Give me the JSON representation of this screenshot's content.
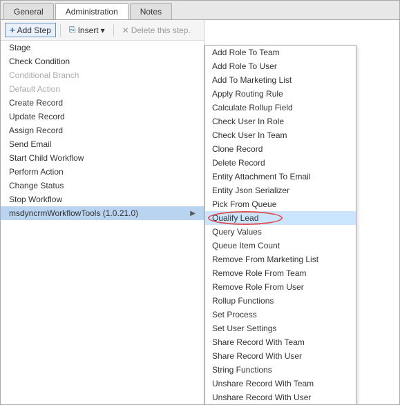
{
  "tabs": [
    {
      "label": "General",
      "active": false
    },
    {
      "label": "Administration",
      "active": true
    },
    {
      "label": "Notes",
      "active": false
    }
  ],
  "toolbar": {
    "add_step_label": "Add Step",
    "insert_label": "Insert",
    "delete_label": "Delete this step."
  },
  "menu_items": [
    {
      "label": "Stage",
      "disabled": false
    },
    {
      "label": "Check Condition",
      "disabled": false
    },
    {
      "label": "Conditional Branch",
      "disabled": true
    },
    {
      "label": "Default Action",
      "disabled": true
    },
    {
      "label": "Create Record",
      "disabled": false
    },
    {
      "label": "Update Record",
      "disabled": false
    },
    {
      "label": "Assign Record",
      "disabled": false
    },
    {
      "label": "Send Email",
      "disabled": false
    },
    {
      "label": "Start Child Workflow",
      "disabled": false
    },
    {
      "label": "Perform Action",
      "disabled": false
    },
    {
      "label": "Change Status",
      "disabled": false
    },
    {
      "label": "Stop Workflow",
      "disabled": false
    },
    {
      "label": "msdyncrmWorkflowTools (1.0.21.0)",
      "disabled": false,
      "has_submenu": true
    }
  ],
  "dropdown_items": [
    {
      "label": "Add Role To Team",
      "highlighted": false
    },
    {
      "label": "Add Role To User",
      "highlighted": false
    },
    {
      "label": "Add To Marketing List",
      "highlighted": false
    },
    {
      "label": "Apply Routing Rule",
      "highlighted": false
    },
    {
      "label": "Calculate Rollup Field",
      "highlighted": false
    },
    {
      "label": "Check User In Role",
      "highlighted": false
    },
    {
      "label": "Check User In Team",
      "highlighted": false
    },
    {
      "label": "Clone Record",
      "highlighted": false
    },
    {
      "label": "Delete Record",
      "highlighted": false
    },
    {
      "label": "Entity Attachment To Email",
      "highlighted": false
    },
    {
      "label": "Entity Json Serializer",
      "highlighted": false
    },
    {
      "label": "Pick From Queue",
      "highlighted": false
    },
    {
      "label": "Qualify Lead",
      "highlighted": true
    },
    {
      "label": "Query Values",
      "highlighted": false
    },
    {
      "label": "Queue Item Count",
      "highlighted": false
    },
    {
      "label": "Remove From Marketing List",
      "highlighted": false
    },
    {
      "label": "Remove Role From Team",
      "highlighted": false
    },
    {
      "label": "Remove Role From User",
      "highlighted": false
    },
    {
      "label": "Rollup Functions",
      "highlighted": false
    },
    {
      "label": "Set Process",
      "highlighted": false
    },
    {
      "label": "Set User Settings",
      "highlighted": false
    },
    {
      "label": "Share Record With Team",
      "highlighted": false
    },
    {
      "label": "Share Record With User",
      "highlighted": false
    },
    {
      "label": "String Functions",
      "highlighted": false
    },
    {
      "label": "Unshare Record With Team",
      "highlighted": false
    },
    {
      "label": "Unshare Record With User",
      "highlighted": false
    }
  ]
}
